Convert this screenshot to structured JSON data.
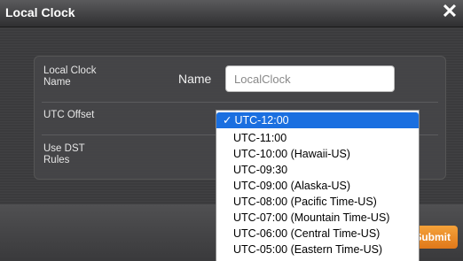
{
  "window": {
    "title": "Local Clock",
    "close_icon": "close-icon"
  },
  "form": {
    "rows": [
      {
        "label": "Local Clock Name"
      },
      {
        "label": "UTC Offset"
      },
      {
        "label": "Use DST Rules"
      }
    ],
    "name_label": "Name",
    "name_value": "LocalClock"
  },
  "dropdown": {
    "check_mark": "✓",
    "options": [
      "UTC-12:00",
      "UTC-11:00",
      "UTC-10:00 (Hawaii-US)",
      "UTC-09:30",
      "UTC-09:00 (Alaska-US)",
      "UTC-08:00 (Pacific Time-US)",
      "UTC-07:00 (Mountain Time-US)",
      "UTC-06:00 (Central Time-US)",
      "UTC-05:00 (Eastern Time-US)"
    ],
    "selected_index": 0
  },
  "footer": {
    "submit_label": "Submit"
  },
  "colors": {
    "accent": "#1a6fe0",
    "submit": "#f0902a"
  }
}
